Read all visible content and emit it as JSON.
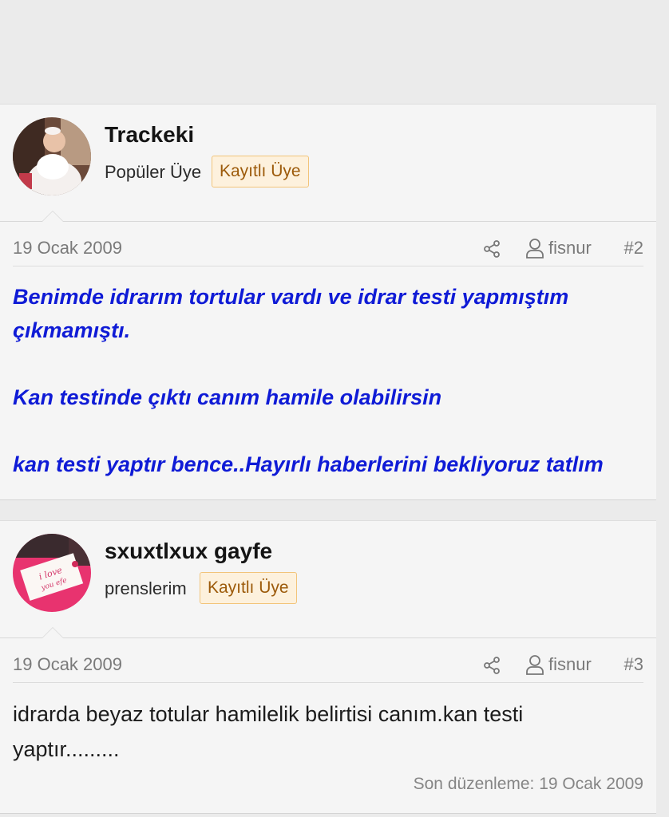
{
  "posts": [
    {
      "username": "Trackeki",
      "user_title": "Popüler Üye",
      "badge": "Kayıtlı Üye",
      "date": "19 Ocak 2009",
      "author": "fisnur",
      "number": "#2",
      "avatar_icon": "baby-photo-avatar",
      "message_lines": [
        "Benimde idrarım tortular vardı ve idrar testi yapmıştım",
        "çıkmamıştı.",
        "Kan testinde çıktı canım hamile olabilirsin",
        "kan testi yaptır bence..Hayırlı haberlerini bekliyoruz tatlım"
      ],
      "message_color": "#0f1bd6"
    },
    {
      "username": "sxuxtlxux gayfe",
      "user_title": "prenslerim",
      "badge": "Kayıtlı Üye",
      "date": "19 Ocak 2009",
      "author": "fisnur",
      "number": "#3",
      "avatar_icon": "love-card-avatar",
      "avatar_text": [
        "i love",
        "you efe"
      ],
      "message": "idrarda beyaz totular hamilelik belirtisi canım.kan testi yaptır.........",
      "edited_note": "Son düzenleme: 19 Ocak 2009"
    }
  ],
  "colors": {
    "badge_bg": "#fdf1dd",
    "badge_border": "#f2c47a",
    "badge_text": "#9c5a0a",
    "meta_text": "#7a7a7a"
  }
}
